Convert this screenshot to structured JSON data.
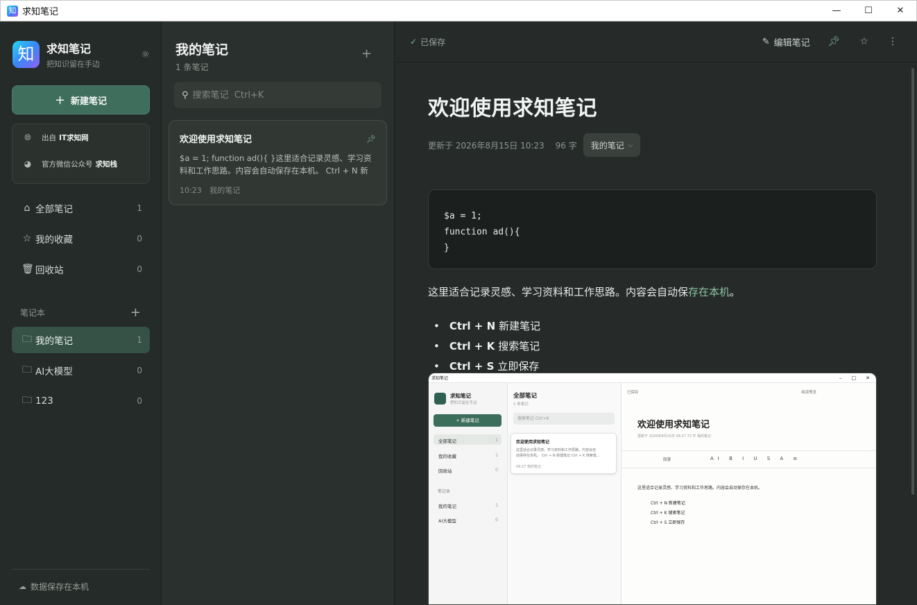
{
  "window": {
    "title": "求知笔记",
    "controls": [
      "—",
      "☐",
      "✕"
    ]
  },
  "sidebar": {
    "app_name": "求知笔记",
    "app_tagline": "把知识留在手边",
    "logo_char": "知",
    "new_note_label": "新建笔记",
    "source": {
      "site_prefix": "出自",
      "site_name": "IT求知网",
      "wechat_prefix": "官方微信公众号",
      "wechat_name": "求知栈"
    },
    "nav": [
      {
        "label": "全部笔记",
        "count": "1",
        "icon": "inbox-icon"
      },
      {
        "label": "我的收藏",
        "count": "0",
        "icon": "star-icon"
      },
      {
        "label": "回收站",
        "count": "0",
        "icon": "trash-icon"
      }
    ],
    "notebooks_header": "笔记本",
    "notebooks": [
      {
        "label": "我的笔记",
        "count": "1",
        "active": true
      },
      {
        "label": "AI大模型",
        "count": "0",
        "active": false
      },
      {
        "label": "123",
        "count": "0",
        "active": false
      }
    ],
    "footer": "数据保存在本机"
  },
  "notelist": {
    "title": "我的笔记",
    "count_text": "1 条笔记",
    "search_placeholder": "搜索笔记  Ctrl+K",
    "notes": [
      {
        "title": "欢迎使用求知笔记",
        "excerpt": "$a = 1; function ad(){ }这里适合记录灵感、学习资料和工作思路。内容会自动保存在本机。 Ctrl + N 新建笔记 Ctrl + K 搜索笔记",
        "time": "10:23",
        "notebook": "我的笔记",
        "pinned": true
      }
    ]
  },
  "editor": {
    "saved_label": "已保存",
    "edit_label": "编辑笔记",
    "doc": {
      "title": "欢迎使用求知笔记",
      "updated": "更新于 2026年8月15日 10:23",
      "words": "96 字",
      "notebook": "我的笔记",
      "code": "$a = 1;\nfunction ad(){\n}",
      "paragraph_main": "这里适合记录灵感、学习资料和工作思路。内容会自动保",
      "paragraph_hl": "存在本机",
      "paragraph_end": "。",
      "shortcuts": [
        {
          "keys": "Ctrl + N",
          "desc": "新建笔记"
        },
        {
          "keys": "Ctrl + K",
          "desc": "搜索笔记"
        },
        {
          "keys": "Ctrl + S",
          "desc": "立即保存"
        }
      ]
    }
  },
  "embedded_screenshot": {
    "window_title": "求知笔记",
    "app_name": "求知笔记",
    "tagline": "把知识留在手边",
    "new_note": "新建笔记",
    "nav": [
      {
        "label": "全部笔记",
        "count": "1"
      },
      {
        "label": "我的收藏",
        "count": "1"
      },
      {
        "label": "回收站",
        "count": "0"
      }
    ],
    "notebooks_header": "笔记本",
    "notebooks": [
      {
        "label": "我的笔记",
        "count": "1"
      },
      {
        "label": "AI大模型",
        "count": "0"
      }
    ],
    "list_title": "全部笔记",
    "list_count": "1 条笔记",
    "search": "搜索笔记  Ctrl+K",
    "card_title": "欢迎使用求知笔记",
    "card_excerpt_1": "这里适合记录灵感、学习资料和工作思路。内容会自",
    "card_excerpt_2": "动保存在本机。 Ctrl + N 新建笔记 Ctrl + K 搜索笔...",
    "card_meta": "09:27  我的笔记",
    "saved": "已保存",
    "preview": "阅读预览",
    "doc_title": "欢迎使用求知笔记",
    "doc_meta": "更新于 2026年8月15日 09:27    72 字    我的笔记",
    "format_para": "段落",
    "para": "这里适合记录灵感、学习资料和工作思路。内容会自动保存在本机。",
    "b1": "Ctrl + N 新建笔记",
    "b2": "Ctrl + K 搜索笔记",
    "b3": "Ctrl + S 立即保存"
  },
  "colors": {
    "accent": "#3f6e5d",
    "active_nav": "#365246",
    "pin": "#7fb09a",
    "link": "#8cc2a7"
  }
}
